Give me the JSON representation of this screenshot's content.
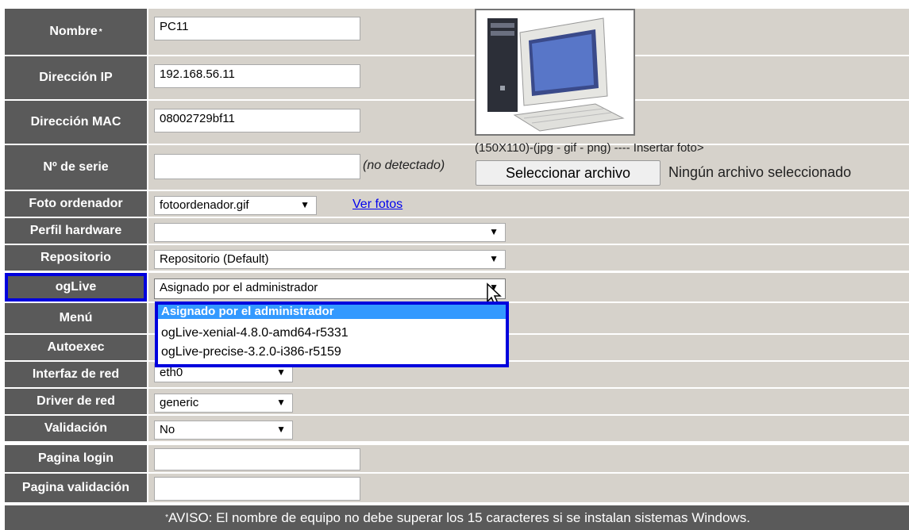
{
  "fields": {
    "nombre": {
      "label": "Nombre",
      "marker": "*",
      "value": "PC11"
    },
    "ip": {
      "label": "Dirección IP",
      "value": "192.168.56.11"
    },
    "mac": {
      "label": "Dirección MAC",
      "value": "08002729bf11"
    },
    "serie": {
      "label": "Nº de serie",
      "value": "",
      "note": "(no detectado)"
    },
    "foto": {
      "label": "Foto ordenador",
      "value": "fotoordenador.gif",
      "link": "Ver fotos"
    },
    "perfil": {
      "label": "Perfil hardware",
      "value": ""
    },
    "repositorio": {
      "label": "Repositorio",
      "value": "Repositorio (Default)"
    },
    "oglive": {
      "label": "ogLive",
      "value": "Asignado por el administrador"
    },
    "menu": {
      "label": "Menú"
    },
    "autoexec": {
      "label": "Autoexec"
    },
    "interfaz": {
      "label": "Interfaz de red",
      "value": "eth0"
    },
    "driver": {
      "label": "Driver de red",
      "value": "generic"
    },
    "validacion": {
      "label": "Validación",
      "value": "No"
    },
    "pagina_login": {
      "label": "Pagina login",
      "value": ""
    },
    "pagina_validacion": {
      "label": "Pagina validación",
      "value": ""
    }
  },
  "photo": {
    "hint": "(150X110)-(jpg - gif - png) ---- Insertar foto>",
    "button": "Seleccionar archivo",
    "status": "Ningún archivo seleccionado"
  },
  "dropdown": {
    "options": [
      "Asignado por el administrador",
      "ogLive-xenial-4.8.0-amd64-r5331",
      "ogLive-precise-3.2.0-i386-r5159"
    ]
  },
  "footer": {
    "marker": "*",
    "text": " AVISO: El nombre de equipo no debe superar los 15 caracteres si se instalan sistemas Windows."
  },
  "colors": {
    "label_bg": "#5a5a5a",
    "value_bg": "#d6d2cb",
    "highlight": "#0000dd",
    "selected": "#3399ff"
  },
  "icons": {
    "select_arrow": "arrow-down-icon",
    "cursor": "mouse-pointer-icon"
  }
}
